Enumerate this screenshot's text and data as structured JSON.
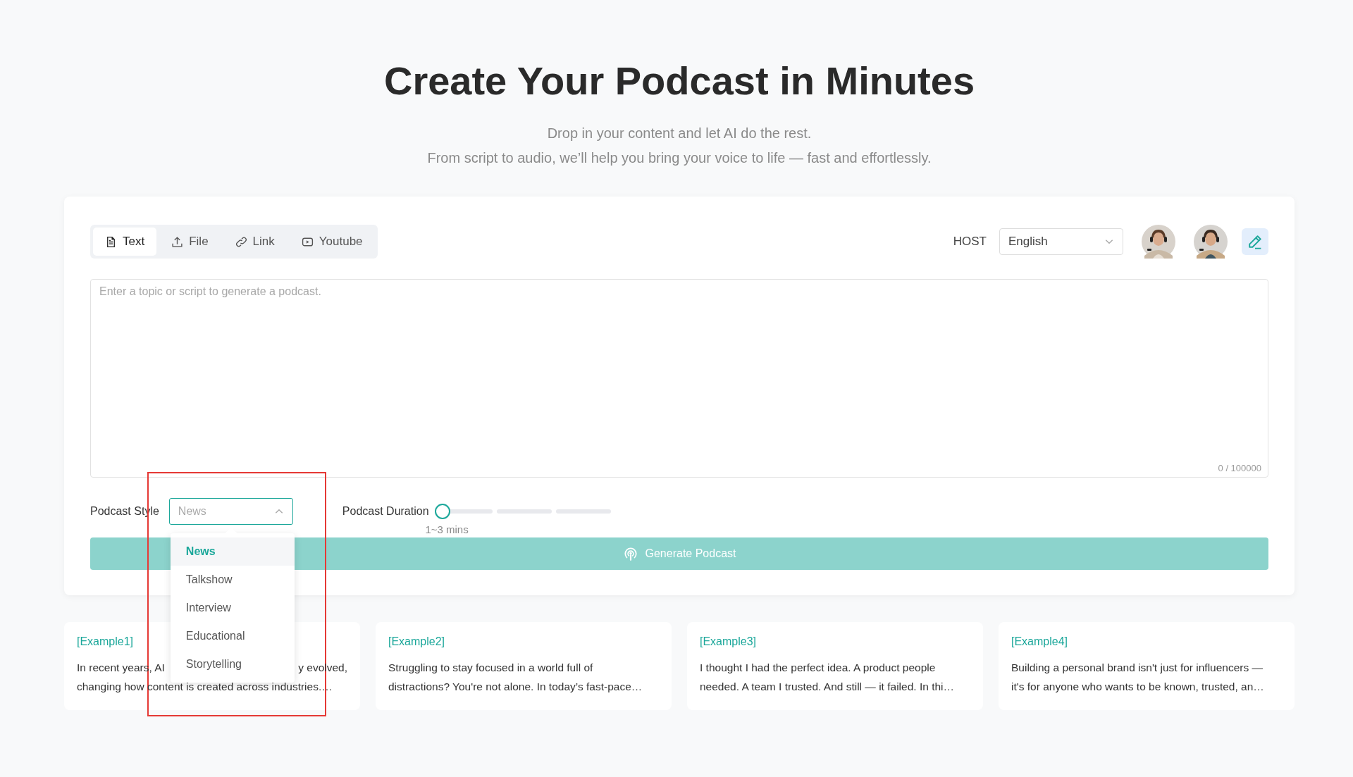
{
  "hero": {
    "title": "Create Your Podcast in Minutes",
    "subtitle_lines": [
      "Drop in your content and let AI do the rest.",
      "From script to audio, we’ll help you bring your voice to life — fast and effortlessly."
    ]
  },
  "tabs": [
    {
      "label": "Text",
      "kind": "text",
      "selected": true
    },
    {
      "label": "File",
      "kind": "file",
      "selected": false
    },
    {
      "label": "Link",
      "kind": "link",
      "selected": false
    },
    {
      "label": "Youtube",
      "kind": "youtube",
      "selected": false
    }
  ],
  "host": {
    "label": "HOST",
    "language": "English"
  },
  "editor": {
    "placeholder": "Enter a topic or script to generate a podcast.",
    "counter": "0 / 100000"
  },
  "style": {
    "label": "Podcast Style",
    "placeholder": "News",
    "expanded": true,
    "options": [
      {
        "label": "News",
        "selected": true
      },
      {
        "label": "Talkshow",
        "selected": false
      },
      {
        "label": "Interview",
        "selected": false
      },
      {
        "label": "Educational",
        "selected": false
      },
      {
        "label": "Storytelling",
        "selected": false
      }
    ]
  },
  "duration": {
    "label": "Podcast Duration",
    "level": 0,
    "reading": "1~3 mins"
  },
  "generate_button": "Generate Podcast",
  "examples": [
    {
      "title": "[Example1]",
      "lines": [
        [
          "In recent years, AI",
          "y evolved,"
        ],
        [
          "changing how content is created across industries.…"
        ]
      ]
    },
    {
      "title": "[Example2]",
      "lines": [
        [
          "Struggling to stay focused in a world full of"
        ],
        [
          "distractions? You're not alone. In today’s fast-pace…"
        ]
      ]
    },
    {
      "title": "[Example3]",
      "lines": [
        [
          "I thought I had the perfect idea. A product people"
        ],
        [
          "needed. A team I trusted. And still — it failed. In thi…"
        ]
      ]
    },
    {
      "title": "[Example4]",
      "lines": [
        [
          "Building a personal brand isn't just for influencers —"
        ],
        [
          "it's for anyone who wants to be known, trusted, an…"
        ]
      ]
    }
  ]
}
